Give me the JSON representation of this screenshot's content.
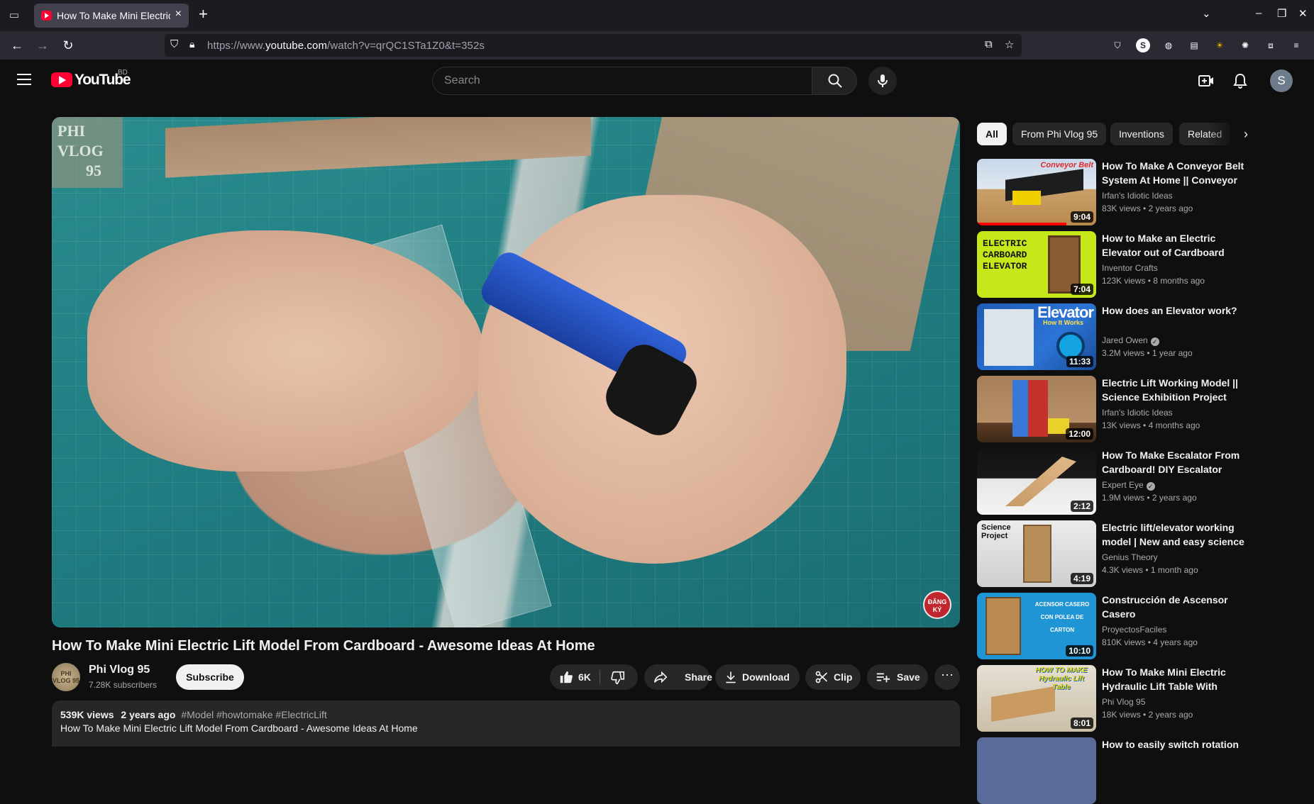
{
  "browser": {
    "tab_title": "How To Make Mini Electric Lift Model From Cardboard - Awesome Ideas At Home - YouTube",
    "tab_close": "×",
    "new_tab": "+",
    "url_prefix": "https://www.",
    "url_host": "youtube.com",
    "url_rest": "/watch?v=qrQC1STa1Z0&t=352s"
  },
  "youtube": {
    "logo_text": "YouTube",
    "country_code": "BD",
    "search_placeholder": "Search",
    "account_initial": "S"
  },
  "video": {
    "title": "How To Make Mini Electric Lift Model From Cardboard - Awesome Ideas At Home",
    "watermark_line1": "PHI",
    "watermark_line2": "VLOG",
    "watermark_line3": "95",
    "subscribe_watermark": "ĐĂNG KÝ",
    "channel_name": "Phi Vlog 95",
    "channel_subscribers": "7.28K subscribers",
    "channel_avatar_text": "PHI VLOG 95",
    "subscribe_label": "Subscribe",
    "like_count": "6K",
    "share_label": "Share",
    "download_label": "Download",
    "clip_label": "Clip",
    "save_label": "Save",
    "views": "539K views",
    "age": "2 years ago",
    "hashtags": "#Model #howtomake #ElectricLift",
    "description": "How To Make Mini Electric Lift Model From Cardboard - Awesome Ideas At Home"
  },
  "chips": [
    "All",
    "From Phi Vlog 95",
    "Inventions",
    "Related"
  ],
  "recommendations": [
    {
      "title": "How To Make A Conveyor Belt System At Home || Conveyor Belt",
      "channel": "Irfan's Idiotic Ideas",
      "verified": false,
      "views": "83K views",
      "age": "2 years ago",
      "duration": "9:04",
      "progress": 0.75,
      "thumb_text": "Conveyor Belt"
    },
    {
      "title": "How to Make an Electric Elevator out of Cardboard",
      "channel": "Inventor Crafts",
      "verified": false,
      "views": "123K views",
      "age": "8 months ago",
      "duration": "7:04",
      "progress": 0,
      "thumb_text": "ELECTRIC CARBOARD ELEVATOR"
    },
    {
      "title": "How does an Elevator work?",
      "channel": "Jared Owen",
      "verified": true,
      "views": "3.2M views",
      "age": "1 year ago",
      "duration": "11:33",
      "progress": 0,
      "thumb_text": "Elevator",
      "thumb_sub": "How It Works"
    },
    {
      "title": "Electric Lift Working Model || Science Exhibition Project",
      "channel": "Irfan's Idiotic Ideas",
      "verified": false,
      "views": "13K views",
      "age": "4 months ago",
      "duration": "12:00",
      "progress": 0,
      "thumb_text": ""
    },
    {
      "title": "How To Make Escalator From Cardboard! DIY Escalator",
      "channel": "Expert Eye",
      "verified": true,
      "views": "1.9M views",
      "age": "2 years ago",
      "duration": "2:12",
      "progress": 0,
      "thumb_text": ""
    },
    {
      "title": "Electric lift/elevator working model | New and easy science project",
      "channel": "Genius Theory",
      "verified": false,
      "views": "4.3K views",
      "age": "1 month ago",
      "duration": "4:19",
      "progress": 0,
      "thumb_text": "Science Project"
    },
    {
      "title": "Construcción de Ascensor Casero",
      "channel": "ProyectosFaciles",
      "verified": false,
      "views": "810K views",
      "age": "4 years ago",
      "duration": "10:10",
      "progress": 0,
      "thumb_text": "ACENSOR CASERO CON POLEA DE CARTON"
    },
    {
      "title": "How To Make Mini Electric Hydraulic Lift Table With Cardboard",
      "channel": "Phi Vlog 95",
      "verified": false,
      "views": "18K views",
      "age": "2 years ago",
      "duration": "8:01",
      "progress": 0,
      "thumb_text": "HOW TO MAKE Hydraulic Lift Table"
    },
    {
      "title": "How to easily switch rotation",
      "channel": "",
      "verified": false,
      "views": "",
      "age": "",
      "duration": "",
      "progress": 0,
      "thumb_text": ""
    }
  ],
  "colors": {
    "background": "#0f0f0f",
    "brand_red": "#ff0033",
    "chip_bg": "#272727",
    "secondary_text": "#aaaaaa"
  }
}
